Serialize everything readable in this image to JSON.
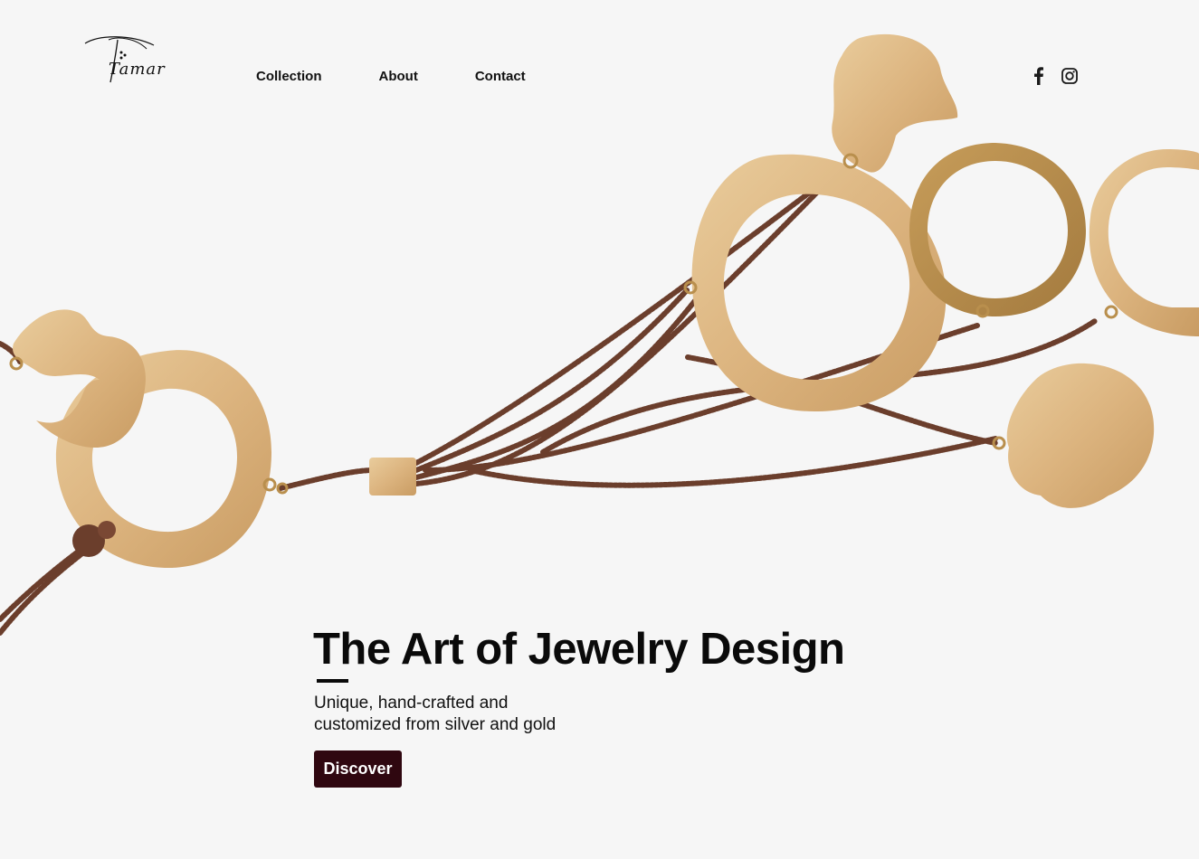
{
  "header": {
    "logo_text": "Tamar",
    "nav": [
      {
        "label": "Collection"
      },
      {
        "label": "About"
      },
      {
        "label": "Contact"
      }
    ],
    "social": [
      {
        "icon": "facebook-icon"
      },
      {
        "icon": "instagram-icon"
      }
    ]
  },
  "hero": {
    "title": "The Art of Jewelry Design",
    "subtitle_line1": "Unique, hand-crafted and",
    "subtitle_line2": "customized from silver and gold",
    "cta_label": "Discover"
  },
  "colors": {
    "background": "#f6f6f6",
    "text": "#0a0a0a",
    "cta_background": "#2f0710",
    "gold": "#dcb784",
    "bead": "#6e4030"
  }
}
